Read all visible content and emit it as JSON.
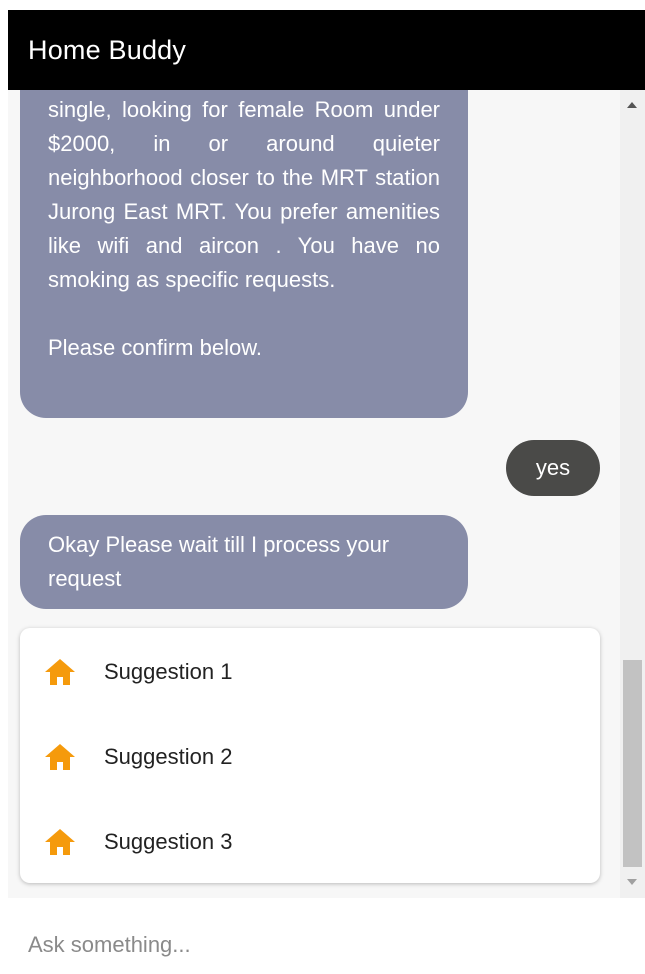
{
  "app": {
    "title": "Home Buddy"
  },
  "messages": {
    "bot_summary": {
      "paragraph1": "single, looking for female Room under $2000, in or around quieter neighborhood closer to the MRT station Jurong East MRT. You prefer amenities like wifi and aircon . You have no smoking as specific requests.",
      "paragraph2": "Please confirm below."
    },
    "user_reply": "yes",
    "bot_wait": "Okay Please wait till I process your request"
  },
  "suggestions": [
    {
      "label": "Suggestion 1",
      "icon": "home-icon"
    },
    {
      "label": "Suggestion 2",
      "icon": "home-icon"
    },
    {
      "label": "Suggestion 3",
      "icon": "home-icon"
    }
  ],
  "input": {
    "value": "",
    "placeholder": "Ask something..."
  },
  "colors": {
    "header_bg": "#000000",
    "bot_bubble": "#878ca8",
    "user_bubble": "#4a4a48",
    "icon_accent": "#f59a0c",
    "chat_bg": "#f7f7f7"
  }
}
